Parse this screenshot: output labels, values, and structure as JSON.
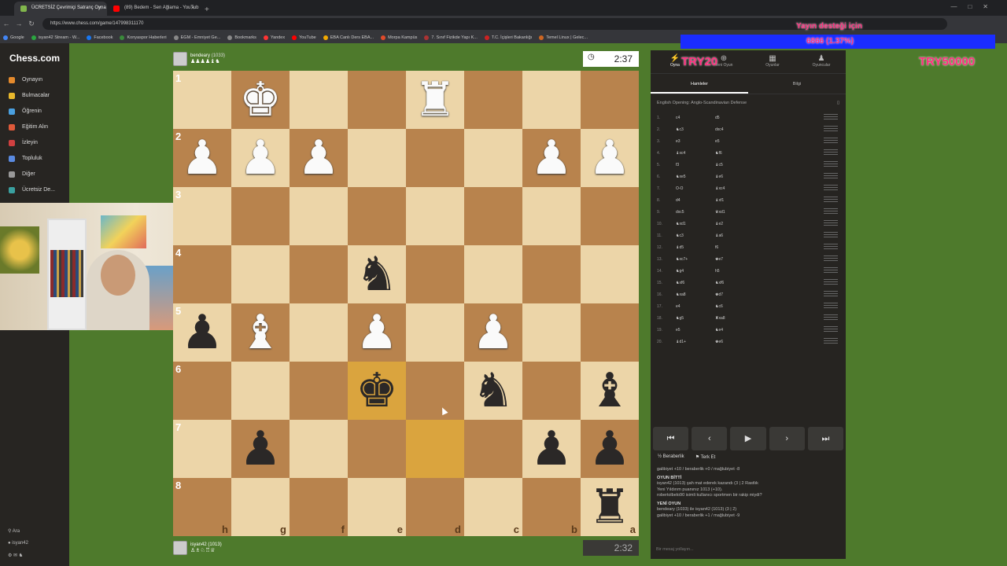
{
  "browser": {
    "tabs": [
      {
        "label": "ÜCRETSİZ Çevrimiçi Satranç Oyna",
        "color": "#81b64c",
        "active": true
      },
      {
        "label": "(89) Bedem - Sen Ağlama - YouTub",
        "color": "#ff0000",
        "active": false
      }
    ],
    "new_tab": "+",
    "url": "https://www.chess.com/game/147998311170",
    "bookmarks": [
      {
        "label": "Google",
        "color": "#4285f4"
      },
      {
        "label": "isyan42 Stream - W...",
        "color": "#2ba640"
      },
      {
        "label": "Facebook",
        "color": "#1877f2"
      },
      {
        "label": "Konyaspor Haberleri",
        "color": "#3a8a3a"
      },
      {
        "label": "EGM - Emniyet Ge...",
        "color": "#888888"
      },
      {
        "label": "Bookmarks",
        "color": "#888888"
      },
      {
        "label": "Yandex",
        "color": "#ff3333"
      },
      {
        "label": "YouTube",
        "color": "#ff0000"
      },
      {
        "label": "EBA Canlı Ders EBA...",
        "color": "#f2a900"
      },
      {
        "label": "Morpa Kampüs",
        "color": "#e04a2a"
      },
      {
        "label": "7. Sınıf Fizikde Yapı K...",
        "color": "#aa3333"
      },
      {
        "label": "T.C. İçişleri Bakanlığı",
        "color": "#cc2222"
      },
      {
        "label": "Temel Linux | Gelec...",
        "color": "#cc6622"
      }
    ]
  },
  "site_nav": {
    "logo_prefix": "",
    "logo": "Chess.com",
    "items": [
      {
        "label": "Oynayın",
        "color": "#e58a2c"
      },
      {
        "label": "Bulmacalar",
        "color": "#e8b82c"
      },
      {
        "label": "Öğrenin",
        "color": "#4aa0e0"
      },
      {
        "label": "Eğitim Alın",
        "color": "#e05a3a"
      },
      {
        "label": "İzleyin",
        "color": "#d04040"
      },
      {
        "label": "Topluluk",
        "color": "#5a8ae0"
      },
      {
        "label": "Diğer",
        "color": "#999999"
      },
      {
        "label": "Ücretsiz De...",
        "color": "#3aa0a0"
      }
    ],
    "search_label": "Ara",
    "user_label": "isyan42"
  },
  "game": {
    "top_player": {
      "name": "bendeary",
      "rating": "(1033)"
    },
    "bottom_player": {
      "name": "isyan42",
      "rating": "(1013)"
    },
    "top_clock": "2:37",
    "bottom_clock": "2:32"
  },
  "board": {
    "orientation": "black",
    "squares": [
      [
        "",
        "wK",
        "",
        "",
        "wR",
        "",
        "",
        ""
      ],
      [
        "wP",
        "wP",
        "wP",
        "",
        "",
        "",
        "wP",
        "wP"
      ],
      [
        "",
        "",
        "",
        "",
        "",
        "",
        "",
        ""
      ],
      [
        "",
        "",
        "",
        "bN",
        "",
        "",
        "",
        ""
      ],
      [
        "bP",
        "wB",
        "",
        "wP",
        "",
        "wP",
        "",
        ""
      ],
      [
        "",
        "",
        "",
        "bK",
        "",
        "bN",
        "",
        "bB"
      ],
      [
        "",
        "bP",
        "",
        "",
        "",
        "",
        "bP",
        "bP"
      ],
      [
        "",
        "",
        "",
        "",
        "",
        "",
        "",
        "bR"
      ]
    ],
    "highlight": [
      [
        5,
        3
      ],
      [
        6,
        4
      ]
    ],
    "ranks": [
      "1",
      "2",
      "3",
      "4",
      "5",
      "6",
      "7",
      "8"
    ],
    "files": [
      "h",
      "g",
      "f",
      "e",
      "d",
      "c",
      "b",
      "a"
    ]
  },
  "panel": {
    "tabs": [
      "Oyna",
      "Yeni Oyun",
      "Oyunlar",
      "Oyuncular"
    ],
    "subtabs": [
      "Hamleler",
      "Bilgi"
    ],
    "opening": "English Opening: Anglo-Scandinavian Defense",
    "moves": [
      {
        "n": "1.",
        "w": "c4",
        "b": "d5"
      },
      {
        "n": "2.",
        "w": "♞c3",
        "b": "dxc4"
      },
      {
        "n": "3.",
        "w": "e3",
        "b": "e5"
      },
      {
        "n": "4.",
        "w": "♝xc4",
        "b": "♞f6"
      },
      {
        "n": "5.",
        "w": "f3",
        "b": "♝c5"
      },
      {
        "n": "6.",
        "w": "♞xe5",
        "b": "♝e6"
      },
      {
        "n": "7.",
        "w": "O-O",
        "b": "♝xc4"
      },
      {
        "n": "8.",
        "w": "d4",
        "b": "♝xf1"
      },
      {
        "n": "9.",
        "w": "dxc5",
        "b": "♛xd1"
      },
      {
        "n": "10.",
        "w": "♞xd1",
        "b": "♝e2"
      },
      {
        "n": "11.",
        "w": "♞c3",
        "b": "♝a6"
      },
      {
        "n": "12.",
        "w": "♝d5",
        "b": "f6"
      },
      {
        "n": "13.",
        "w": "♞xc7+",
        "b": "♚e7"
      },
      {
        "n": "14.",
        "w": "♞g4",
        "b": "h5"
      },
      {
        "n": "15.",
        "w": "♞xf6",
        "b": "♞xf6"
      },
      {
        "n": "16.",
        "w": "♞xa8",
        "b": "♚d7"
      },
      {
        "n": "17.",
        "w": "e4",
        "b": "♞c6"
      },
      {
        "n": "18.",
        "w": "♞g5",
        "b": "♜xa8"
      },
      {
        "n": "19.",
        "w": "e5",
        "b": "♞e4"
      },
      {
        "n": "20.",
        "w": "♝d1+",
        "b": "♚e6"
      }
    ],
    "controls": [
      "⏮",
      "‹",
      "▶",
      "›",
      "⏭"
    ],
    "draw": "Beraberlik",
    "resign": "Terk Et",
    "chat": [
      {
        "h": "",
        "t": "galibiyet +10 / beraberlik +0 / mağlubiyet -8"
      },
      {
        "h": "OYUN BİTTİ",
        "t": ""
      },
      {
        "h": "",
        "t": "isyan42 (1013) şah mat ederek kazandı (3 | 2 Rastlık"
      },
      {
        "h": "",
        "t": "Yeni Yıldırım puanınız 1013 (+10)."
      },
      {
        "h": "",
        "t": "robertolbelo90 isimli kullanıcı sportmen bir rakip miydi?"
      },
      {
        "h": "YENİ OYUN",
        "t": ""
      },
      {
        "h": "",
        "t": "bendeary (1033) ile isyan42 (1013) (3 | 2)"
      },
      {
        "h": "",
        "t": "galibiyet +10 / beraberlik +1 / mağlubiyet -9"
      }
    ],
    "message_placeholder": "Bir mesaj yollayın..."
  },
  "overlay": {
    "donation": "Yayın desteği için",
    "progress": "6866 (1.37%)",
    "goal_left": "TRY20",
    "goal_right": "TRY50000"
  },
  "colors": {
    "accent": "#81b64c",
    "light_square": "#ecd5a8",
    "dark_square": "#b8834d",
    "overlay": "#ff2e7e"
  }
}
